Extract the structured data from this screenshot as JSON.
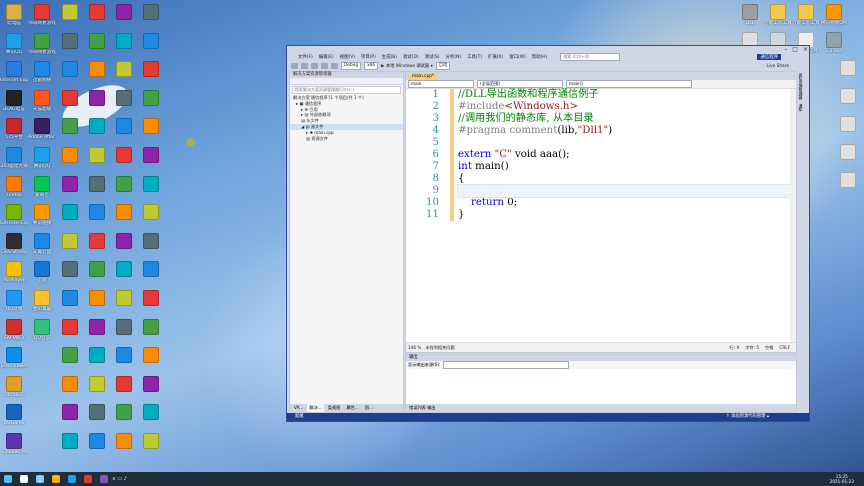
{
  "desktop_icons_left": [
    {
      "label": "此电脑",
      "color": "#d6b14a"
    },
    {
      "label": "腾讯QQ",
      "color": "#1fa0e8"
    },
    {
      "label": "Internet Explorer",
      "color": "#2a7be0"
    },
    {
      "label": "BLAG电竞",
      "color": "#222222"
    },
    {
      "label": "575平台",
      "color": "#c62828"
    },
    {
      "label": "360驱动大师",
      "color": "#1e88e5"
    },
    {
      "label": "Firefox",
      "color": "#ff7a00"
    },
    {
      "label": "GeForce Experience",
      "color": "#76b900"
    },
    {
      "label": "OBS Studio",
      "color": "#302e31"
    },
    {
      "label": "PotPlayer",
      "color": "#f6c200"
    },
    {
      "label": "QQ游戏",
      "color": "#2196f3"
    },
    {
      "label": "SAI Ver.2",
      "color": "#d32f2f"
    },
    {
      "label": "TeamViewer",
      "color": "#0e8ee9"
    },
    {
      "label": "UltraISO",
      "color": "#e0a02a"
    },
    {
      "label": "WeGame",
      "color": "#1565c0"
    },
    {
      "label": "Windows Movie Maker",
      "color": "#5e35b1"
    }
  ],
  "desktop_icons_col2": [
    {
      "label": "师哥网易游戏",
      "color": "#e53935"
    },
    {
      "label": "师哥网易游戏",
      "color": "#43a047"
    },
    {
      "label": "迅雷网络",
      "color": "#1e88e5"
    },
    {
      "label": "天猫超级",
      "color": "#ff5722"
    },
    {
      "label": "Adobe After Effects",
      "color": "#3b1e5d"
    },
    {
      "label": "腾讯QQ",
      "color": "#1fa0e8"
    },
    {
      "label": "爱奇艺",
      "color": "#00c853"
    },
    {
      "label": "腾讯视频",
      "color": "#ff9800"
    },
    {
      "label": "天翼云盘",
      "color": "#1e88e5"
    },
    {
      "label": "迅雷",
      "color": "#1976d2"
    },
    {
      "label": "金山毒霸",
      "color": "#fbc02d"
    },
    {
      "label": "QQ音乐",
      "color": "#31c27c"
    }
  ],
  "vs": {
    "menu": [
      "文件(F)",
      "编辑(E)",
      "视图(V)",
      "项目(P)",
      "生成(B)",
      "调试(D)",
      "测试(S)",
      "分析(N)",
      "工具(T)",
      "扩展(X)",
      "窗口(W)",
      "帮助(H)"
    ],
    "search_placeholder": "搜索 (Ctrl+Q)",
    "solution_name": "通信程序",
    "toolbar": {
      "config": "Debug",
      "platform": "x86",
      "run": "▶ 本地 Windows 调试器 ▾",
      "auto": "自动",
      "live_share": "Live Share"
    },
    "solution_explorer": {
      "title": "解决方案资源管理器",
      "search": "搜索解决方案资源管理器(Ctrl+;)",
      "tree": [
        "解决方案'通信程序'(1 个项目/共 1 个)",
        "▸ ▣ 通信程序",
        "▸ ⊕ 引用",
        "▸ ▤ 外部依赖项",
        "  ▤ 头文件",
        "◢ ▤ 源文件",
        "▸ ✚ main.cpp",
        "  ▤ 资源文件"
      ],
      "tabs": [
        "VA...",
        "解决...",
        "类视图",
        "属性...",
        "团..."
      ]
    },
    "editor": {
      "tab": "main.cpp*",
      "scope1": "main",
      "scope2": "(全局范围)",
      "scope3": "main()",
      "lines": [
        "1",
        "2",
        "3",
        "4",
        "5",
        "6",
        "7",
        "8",
        "9",
        "10",
        "11"
      ],
      "code": {
        "l1": "//DLL导出函数和程序通信例子",
        "l2a": "#include",
        "l2b": "<Windows.h>",
        "l3": "//调用我们的静态库, 从本目录",
        "l4a": "#pragma comment",
        "l4b": "(lib,",
        "l4c": "\"Dll1\"",
        "l4d": ")",
        "l6a": "extern ",
        "l6b": "\"C\"",
        "l6c": " void aaa();",
        "l7a": "int",
        "l7b": " main()",
        "l8": "{",
        "l10a": "    ",
        "l10b": "return",
        "l10c": " 0;",
        "l11": "}"
      },
      "zoom": "146 %",
      "status": "未找到相关问题",
      "pos": [
        "行: 9",
        "字符: 5",
        "空格",
        "CRLF"
      ]
    },
    "output": {
      "title": "输出",
      "source_label": "显示输出来源(S):",
      "bottom": "错误列表 输出"
    },
    "side_tabs": [
      "团队资源管理器",
      "通知"
    ],
    "status_left": "就绪",
    "status_right": "↑ 添加到源代码管理 ▴"
  },
  "desktop_icons_right": [
    {
      "label": "DLL",
      "color": "#9e9e9e"
    },
    {
      "label": "万能工人工具",
      "color": "#f2c94c"
    },
    {
      "label": "万能工人工具2.zip",
      "color": "#f2c94c"
    },
    {
      "label": "腾讯视频OM",
      "color": "#ff9800"
    },
    {
      "label": "CS.CE",
      "color": "#e0e0e0"
    },
    {
      "label": "回收站",
      "color": "#cfd8dc"
    },
    {
      "label": "2021年1月",
      "color": "#eeeeee"
    },
    {
      "label": "G5.exe",
      "color": "#90a4ae"
    }
  ],
  "taskbar": {
    "time": "15:25",
    "date": "2021-01-23"
  }
}
